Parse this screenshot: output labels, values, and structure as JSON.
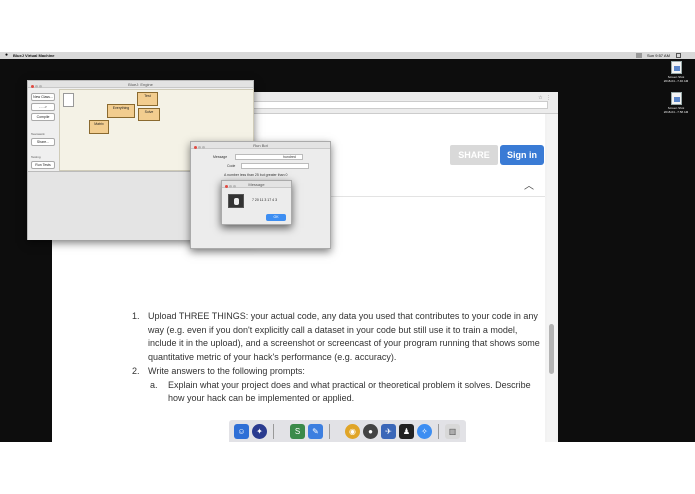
{
  "menubar": {
    "app_name": "BlueJ Virtual Machine",
    "clock": "Sun 9:57 AM",
    "apple": ""
  },
  "desktop": {
    "files": [
      {
        "name": "Screen Shot",
        "sub": "2018-04...7.46 AM"
      },
      {
        "name": "Screen Shot",
        "sub": "2018-04...7.58 AM"
      }
    ]
  },
  "browser": {
    "share_label": "SHARE",
    "signin_label": "Sign in",
    "chevron": "︿",
    "instructions": [
      {
        "num": "1.",
        "text": "Upload THREE THINGS: your actual code, any data you used that contributes to your code in any way (e.g. even if you don't explicitly call a dataset in your code but still use it to train a model, include it in the upload), and a screenshot or screencast of your program running that shows some quantitative metric of your hack's performance (e.g. accuracy)."
      },
      {
        "num": "2.",
        "text": "Write answers to the following prompts:"
      }
    ],
    "subitems": [
      {
        "num": "a.",
        "text": "Explain what your project does and what practical or theoretical problem it solves. Describe how your hack can be implemented or applied."
      }
    ]
  },
  "bluej": {
    "title": "BlueJ: Engine",
    "buttons": {
      "new_class": "New Class...",
      "arrow": "- - ->",
      "compile": "Compile",
      "share": "Share...",
      "run_tests": "Run Tests"
    },
    "labels": {
      "teamwork": "Teamwork",
      "testing": "Testing"
    },
    "classes": {
      "test": "Test",
      "everything": "Everything",
      "solve": "Solve",
      "matrix": "Matrix"
    }
  },
  "dialog": {
    "title": "Run Bot",
    "field1_label": "Message",
    "field1_value": "hundred",
    "field2_label": "Code",
    "hint": "A number less than 25 but greater than 0"
  },
  "message": {
    "title": "Message",
    "text": "7 20 11 3 17 4 3",
    "ok_label": "OK"
  },
  "colors": {
    "accent": "#3a7bd5",
    "class_fill": "#f2cd8f",
    "desktop": "#0d0d0d"
  }
}
